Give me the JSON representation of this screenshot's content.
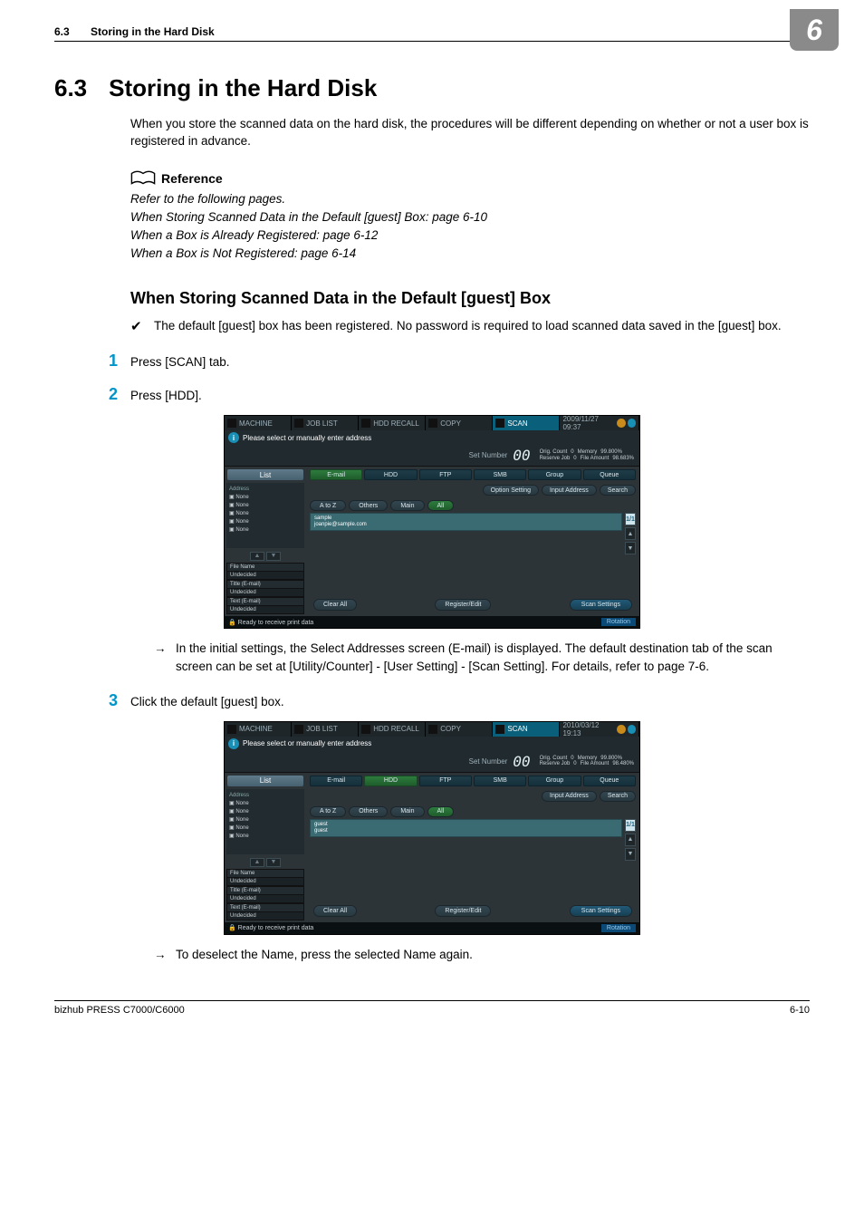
{
  "header": {
    "secnum": "6.3",
    "sectitle": "Storing in the Hard Disk",
    "chapter": "6"
  },
  "h1": {
    "num": "6.3",
    "title": "Storing in the Hard Disk"
  },
  "intro": "When you store the scanned data on the hard disk, the procedures  will be different depending on whether or not a user box is registered in advance.",
  "reference": {
    "head": "Reference",
    "lines": [
      "Refer to the following pages.",
      "When Storing Scanned Data in the Default [guest] Box: page 6-10",
      "When a Box is Already Registered: page 6-12",
      "When a Box is Not Registered: page 6-14"
    ]
  },
  "subsection": "When Storing Scanned Data in the Default [guest] Box",
  "check": "The default [guest] box has been registered. No password is required to load scanned data saved in the [guest] box.",
  "steps": {
    "s1": {
      "n": "1",
      "t": "Press [SCAN] tab."
    },
    "s2": {
      "n": "2",
      "t": "Press [HDD]."
    },
    "s3": {
      "n": "3",
      "t": "Click the default [guest] box."
    }
  },
  "note_after_s2": "In the initial settings, the Select Addresses screen (E-mail) is displayed.  The default destination tab of the scan screen can be set at [Utility/Counter] - [User Setting] - [Scan Setting]. For details, refer to page 7-6.",
  "note_after_s3": "To deselect the Name, press the selected Name again.",
  "footer": {
    "model": "bizhub PRESS C7000/C6000",
    "page": "6-10"
  },
  "shot1": {
    "tabs": [
      "MACHINE",
      "JOB LIST",
      "HDD RECALL",
      "COPY",
      "SCAN"
    ],
    "timestamp": "2009/11/27 09:37",
    "prompt": "Please select or manually enter address",
    "setnum_label": "Set Number",
    "setnum": "00",
    "counts": {
      "orig_l": "Orig. Count",
      "orig_v": "0",
      "res_l": "Reserve Job",
      "res_v": "0",
      "mem_l": "Memory",
      "mem_v": "99.800%",
      "file_l": "File Amount",
      "file_v": "98.683%"
    },
    "side": {
      "list": "List",
      "addr": "Address",
      "none": "None",
      "meta": [
        {
          "l": "File Name",
          "v": "Undecided"
        },
        {
          "l": "Title (E-mail)",
          "v": "Undecided"
        },
        {
          "l": "Text (E-mail)",
          "v": "Undecided"
        }
      ]
    },
    "desttabs": [
      "E-mail",
      "HDD",
      "FTP",
      "SMB",
      "Group",
      "Queue"
    ],
    "active_desttab": 0,
    "toolbtns": [
      "Option Setting",
      "Input Address",
      "Search"
    ],
    "filters": [
      "A to Z",
      "Others",
      "Main",
      "All"
    ],
    "active_filter": 3,
    "item": {
      "name": "sample",
      "detail": "joanpie@sample.com"
    },
    "scroll": "1/1",
    "foot": {
      "clear": "Clear All",
      "reg": "Register/Edit",
      "scan": "Scan Settings"
    },
    "status": {
      "msg": "Ready to receive print data",
      "rot": "Rotation"
    }
  },
  "shot2": {
    "tabs": [
      "MACHINE",
      "JOB LIST",
      "HDD RECALL",
      "COPY",
      "SCAN"
    ],
    "timestamp": "2010/03/12 19:13",
    "prompt": "Please select or manually enter address",
    "setnum_label": "Set Number",
    "setnum": "00",
    "counts": {
      "orig_l": "Orig. Count",
      "orig_v": "0",
      "res_l": "Reserve Job",
      "res_v": "0",
      "mem_l": "Memory",
      "mem_v": "99.800%",
      "file_l": "File Amount",
      "file_v": "98.480%"
    },
    "side": {
      "list": "List",
      "addr": "Address",
      "none": "None",
      "meta": [
        {
          "l": "File Name",
          "v": "Undecided"
        },
        {
          "l": "Title (E-mail)",
          "v": "Undecided"
        },
        {
          "l": "Text (E-mail)",
          "v": "Undecided"
        }
      ]
    },
    "desttabs": [
      "E-mail",
      "HDD",
      "FTP",
      "SMB",
      "Group",
      "Queue"
    ],
    "active_desttab": 1,
    "toolbtns": [
      "Input Address",
      "Search"
    ],
    "filters": [
      "A to Z",
      "Others",
      "Main",
      "All"
    ],
    "active_filter": 3,
    "item": {
      "name": "guest",
      "detail": "guest"
    },
    "scroll": "1/1",
    "foot": {
      "clear": "Clear All",
      "reg": "Register/Edit",
      "scan": "Scan Settings"
    },
    "status": {
      "msg": "Ready to receive print data",
      "rot": "Rotation"
    }
  }
}
